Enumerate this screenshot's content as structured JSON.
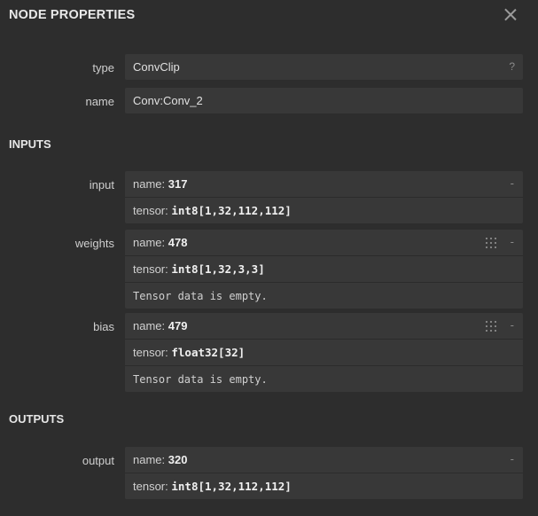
{
  "panel": {
    "title": "NODE PROPERTIES",
    "close_icon": "close-icon"
  },
  "attributes": {
    "type": {
      "label": "type",
      "value": "ConvClip",
      "help": "?"
    },
    "name": {
      "label": "name",
      "value": "Conv:Conv_2"
    }
  },
  "inputs_heading": "INPUTS",
  "outputs_heading": "OUTPUTS",
  "common": {
    "name_key": "name:",
    "tensor_key": "tensor:",
    "collapse": "-"
  },
  "inputs": [
    {
      "label": "input",
      "name": "317",
      "tensor": "int8[1,32,112,112]"
    },
    {
      "label": "weights",
      "name": "478",
      "tensor": "int8[1,32,3,3]",
      "note": "Tensor data is empty."
    },
    {
      "label": "bias",
      "name": "479",
      "tensor": "float32[32]",
      "note": "Tensor data is empty."
    }
  ],
  "outputs": [
    {
      "label": "output",
      "name": "320",
      "tensor": "int8[1,32,112,112]"
    }
  ]
}
